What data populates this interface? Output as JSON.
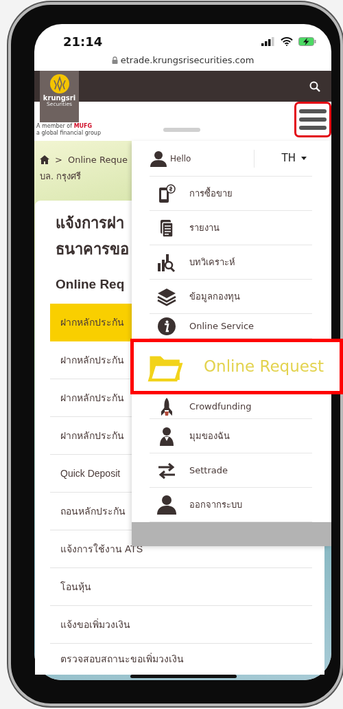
{
  "status_bar": {
    "time": "21:14"
  },
  "browser": {
    "url": "etrade.krungsrisecurities.com"
  },
  "header": {
    "logo": {
      "name": "krungsri",
      "subtitle": "Securities",
      "tagline_1": "A member of",
      "tagline_2": "MUFG",
      "tagline_3": "a global financial group"
    },
    "menu_button": {
      "highlighted": true
    }
  },
  "breadcrumb": {
    "separator": ">",
    "current": "Online Reque"
  },
  "company": "บล. กรุงศรี",
  "page": {
    "title_lines": [
      "แจ้งการฝา",
      "ธนาคารขอ"
    ],
    "section": "Online Req",
    "items": [
      {
        "label": "ฝากหลักประกัน",
        "selected": true
      },
      {
        "label": "ฝากหลักประกัน",
        "selected": false
      },
      {
        "label": "ฝากหลักประกัน",
        "selected": false
      },
      {
        "label": "ฝากหลักประกัน",
        "selected": false
      },
      {
        "label": "Quick Deposit",
        "selected": false
      },
      {
        "label": "ถอนหลักประกัน",
        "selected": false
      },
      {
        "label": "แจ้งการใช้งาน ATS",
        "selected": false
      },
      {
        "label": "โอนหุ้น",
        "selected": false
      },
      {
        "label": "แจ้งขอเพิ่มวงเงิน",
        "selected": false
      },
      {
        "label": "ตรวจสอบสถานะขอเพิ่มวงเงิน",
        "selected": false
      }
    ]
  },
  "menu": {
    "greeting": "Hello",
    "language": "TH",
    "items": [
      {
        "label": "การซื้อขาย",
        "highlighted": false
      },
      {
        "label": "รายงาน",
        "highlighted": false
      },
      {
        "label": "บทวิเคราะห์",
        "highlighted": false
      },
      {
        "label": "ข้อมูลกองทุน",
        "highlighted": false
      },
      {
        "label": "Online Service",
        "highlighted": false
      },
      {
        "label": "Online Request",
        "highlighted": true
      },
      {
        "label": "Crowdfunding",
        "highlighted": false
      },
      {
        "label": "มุมของฉัน",
        "highlighted": false
      },
      {
        "label": "Settrade",
        "highlighted": false
      },
      {
        "label": "ออกจากระบบ",
        "highlighted": false
      }
    ]
  }
}
